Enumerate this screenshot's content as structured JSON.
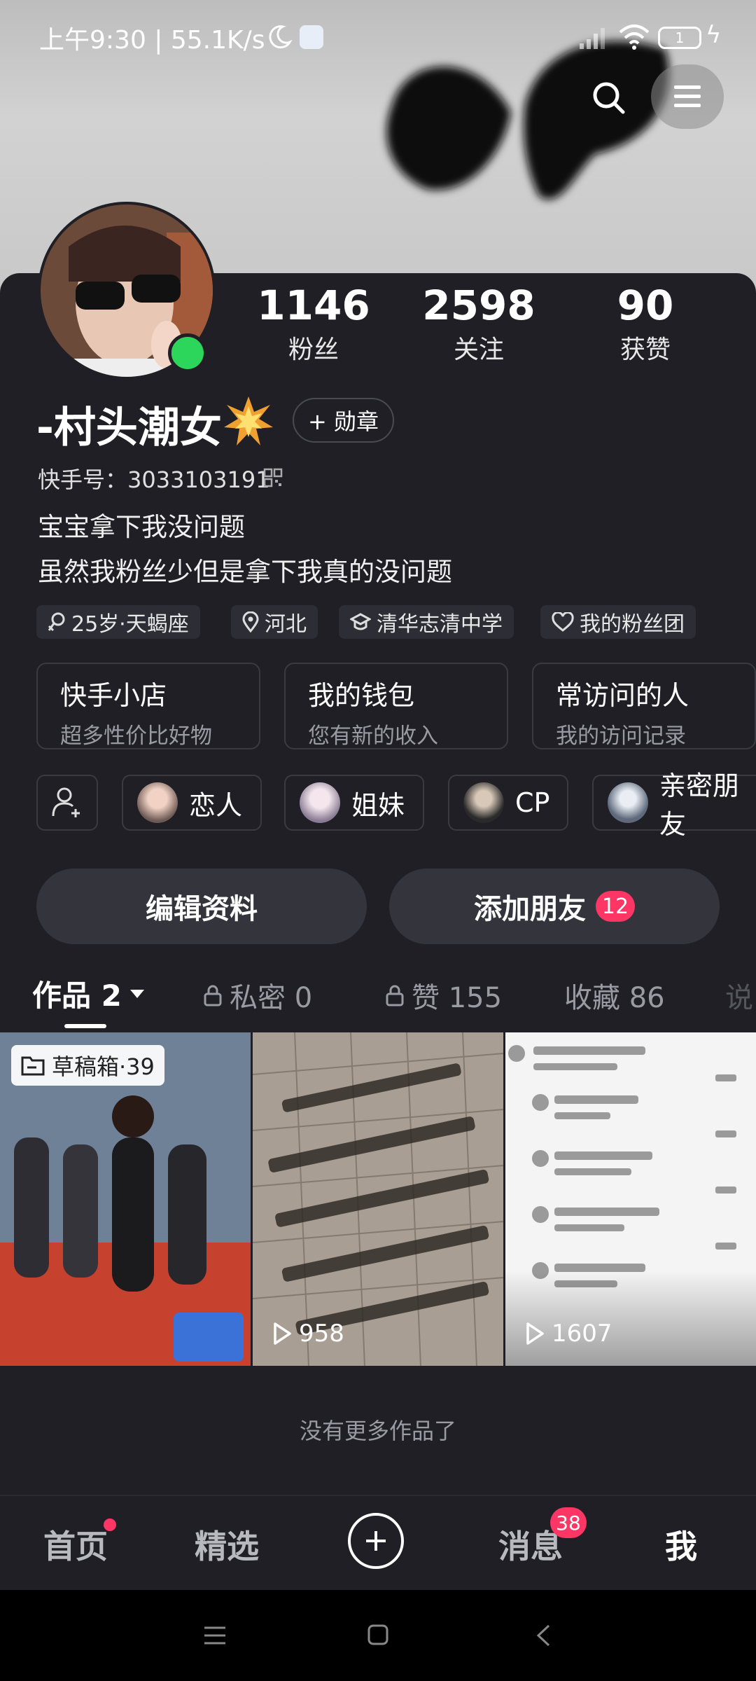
{
  "status_bar": {
    "time_speed": "上午9:30 | 55.1K/s",
    "battery": "1"
  },
  "profile": {
    "name": "-村头潮女",
    "medal_button": "+ 勋章",
    "kuaishou_id": "快手号：3033103191",
    "bio_line1": "宝宝拿下我没问题",
    "bio_line2": "虽然我粉丝少但是拿下我真的没问题",
    "online_color": "#2bd65a"
  },
  "stats": [
    {
      "value": "1146",
      "label": "粉丝"
    },
    {
      "value": "2598",
      "label": "关注"
    },
    {
      "value": "90",
      "label": "获赞"
    }
  ],
  "tags": [
    {
      "icon": "female-icon",
      "text": "25岁·天蝎座"
    },
    {
      "icon": "location-icon",
      "text": "河北"
    },
    {
      "icon": "school-icon",
      "text": "清华志清中学"
    },
    {
      "icon": "heart-icon",
      "text": "我的粉丝团"
    }
  ],
  "entries": [
    {
      "title": "快手小店",
      "sub": "超多性价比好物"
    },
    {
      "title": "我的钱包",
      "sub": "您有新的收入"
    },
    {
      "title": "常访问的人",
      "sub": "我的访问记录"
    }
  ],
  "relations": [
    "恋人",
    "姐妹",
    "CP",
    "亲密朋友"
  ],
  "buttons": {
    "edit": "编辑资料",
    "add_friend": "添加朋友",
    "add_friend_badge": "12"
  },
  "tabs": [
    {
      "label": "作品 2"
    },
    {
      "label": "私密 0"
    },
    {
      "label": "赞 155"
    },
    {
      "label": "收藏 86"
    },
    {
      "label": "说"
    }
  ],
  "videos": [
    {
      "badge": "草稿箱·39"
    },
    {
      "plays": "958"
    },
    {
      "plays": "1607"
    }
  ],
  "no_more": "没有更多作品了",
  "bottom_nav": {
    "home": "首页",
    "featured": "精选",
    "messages": "消息",
    "messages_badge": "38",
    "me": "我"
  },
  "accent_color": "#fe3666"
}
